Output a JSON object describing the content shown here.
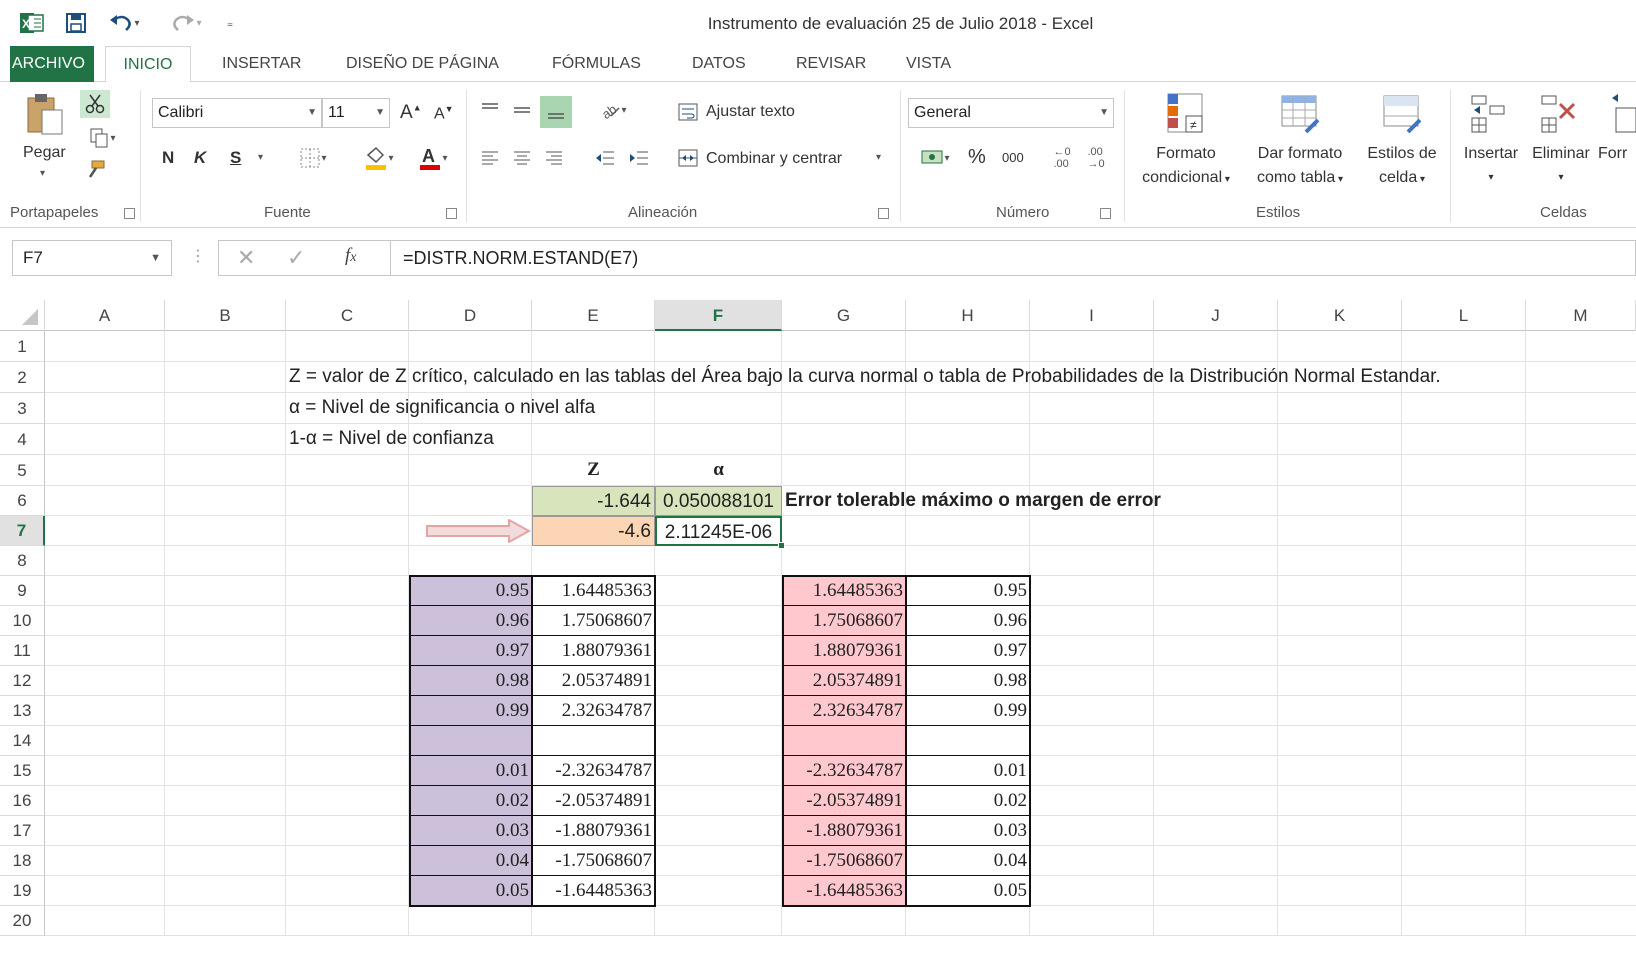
{
  "window": {
    "title": "Instrumento de evaluación 25 de Julio 2018 - Excel"
  },
  "tabs": [
    "ARCHIVO",
    "INICIO",
    "INSERTAR",
    "DISEÑO DE PÁGINA",
    "FÓRMULAS",
    "DATOS",
    "REVISAR",
    "VISTA"
  ],
  "ribbon": {
    "paste": "Pegar",
    "font_name": "Calibri",
    "font_size": "11",
    "bold": "N",
    "italic": "K",
    "underline": "S",
    "wrap_text": "Ajustar texto",
    "merge_center": "Combinar y centrar",
    "number_format": "General",
    "percent": "%",
    "thousands": "000",
    "cond_format_1": "Formato",
    "cond_format_2": "condicional",
    "table_format_1": "Dar formato",
    "table_format_2": "como tabla",
    "cell_styles_1": "Estilos de",
    "cell_styles_2": "celda",
    "insert": "Insertar",
    "delete": "Eliminar",
    "format": "Forr",
    "groups": {
      "clipboard": "Portapapeles",
      "font": "Fuente",
      "alignment": "Alineación",
      "number": "Número",
      "styles": "Estilos",
      "cells": "Celdas"
    }
  },
  "formula_bar": {
    "name_box": "F7",
    "formula": "=DISTR.NORM.ESTAND(E7)",
    "fx": "fx"
  },
  "columns": [
    "A",
    "B",
    "C",
    "D",
    "E",
    "F",
    "G",
    "H",
    "I",
    "J",
    "K",
    "L",
    "M"
  ],
  "rows": [
    "1",
    "2",
    "3",
    "4",
    "5",
    "6",
    "7",
    "8",
    "9",
    "10",
    "11",
    "12",
    "13",
    "14",
    "15",
    "16",
    "17",
    "18",
    "19",
    "20"
  ],
  "text": {
    "c2": "Z = valor de Z crítico, calculado en las tablas del Área bajo la curva normal o tabla de Probabilidades de la Distribución Normal Estandar.",
    "c3": "α = Nivel de significancia o nivel alfa",
    "c4": "1-α = Nivel de confianza",
    "e5": "Z",
    "f5": "α",
    "e6": "-1.644",
    "f6": "0.050088101",
    "g6": "Error tolerable máximo o margen de error",
    "e7": "-4.6",
    "f7": "2.11245E-06"
  },
  "table_left": [
    [
      "0.95",
      "1.64485363"
    ],
    [
      "0.96",
      "1.75068607"
    ],
    [
      "0.97",
      "1.88079361"
    ],
    [
      "0.98",
      "2.05374891"
    ],
    [
      "0.99",
      "2.32634787"
    ],
    [
      "",
      ""
    ],
    [
      "0.01",
      "-2.32634787"
    ],
    [
      "0.02",
      "-2.05374891"
    ],
    [
      "0.03",
      "-1.88079361"
    ],
    [
      "0.04",
      "-1.75068607"
    ],
    [
      "0.05",
      "-1.64485363"
    ]
  ],
  "table_right": [
    [
      "1.64485363",
      "0.95"
    ],
    [
      "1.75068607",
      "0.96"
    ],
    [
      "1.88079361",
      "0.97"
    ],
    [
      "2.05374891",
      "0.98"
    ],
    [
      "2.32634787",
      "0.99"
    ],
    [
      "",
      ""
    ],
    [
      "-2.32634787",
      "0.01"
    ],
    [
      "-2.05374891",
      "0.02"
    ],
    [
      "-1.88079361",
      "0.03"
    ],
    [
      "-1.75068607",
      "0.04"
    ],
    [
      "-1.64485363",
      "0.05"
    ]
  ],
  "colors": {
    "excel_green": "#217346",
    "purple_fill": "#ccc0da",
    "pink_fill": "#ffc7ce",
    "green_fill": "#d8e4bc",
    "orange_fill": "#fcd5b4",
    "arrow_fill": "#f2dcdb",
    "arrow_stroke": "#e6a5a5"
  },
  "icons": [
    "excel-logo-icon",
    "save-icon",
    "undo-icon",
    "redo-icon",
    "customize-qat-icon",
    "paste-icon",
    "cut-icon",
    "copy-icon",
    "format-painter-icon",
    "arrow-right-icon"
  ]
}
